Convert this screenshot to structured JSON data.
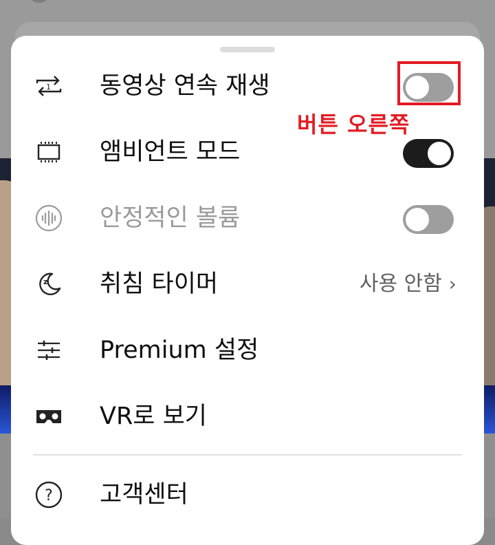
{
  "menu": {
    "items": [
      {
        "label": "동영상 연속 재생",
        "icon": "autoplay-icon",
        "control": "toggle",
        "state": "off"
      },
      {
        "label": "앰비언트 모드",
        "icon": "ambient-mode-icon",
        "control": "toggle",
        "state": "on"
      },
      {
        "label": "안정적인 볼륨",
        "icon": "stable-volume-icon",
        "control": "toggle",
        "state": "off",
        "disabled": true
      },
      {
        "label": "취침 타이머",
        "icon": "sleep-timer-icon",
        "control": "value",
        "value": "사용 안함"
      },
      {
        "label": "Premium 설정",
        "icon": "settings-sliders-icon"
      },
      {
        "label": "VR로 보기",
        "icon": "vr-headset-icon"
      },
      {
        "label": "고객센터",
        "icon": "help-icon"
      }
    ]
  },
  "annotation": {
    "text": "버튼 오른쪽",
    "color": "#e31b23"
  },
  "colors": {
    "toggle_on": "#1c1c1c",
    "toggle_off": "#9e9e9e",
    "annotation_red": "#e31b23"
  }
}
